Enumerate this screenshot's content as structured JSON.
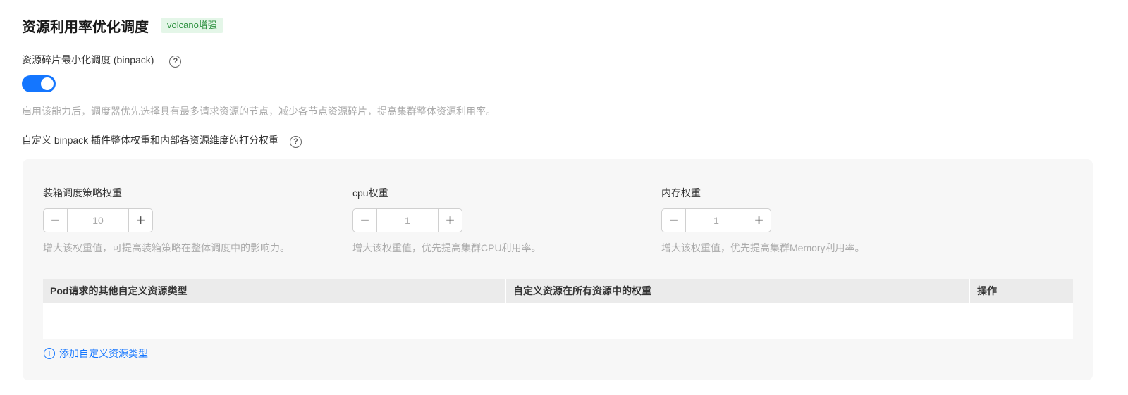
{
  "header": {
    "title": "资源利用率优化调度",
    "tag": "volcano增强"
  },
  "binpack": {
    "label": "资源碎片最小化调度 (binpack)",
    "help_icon": "?",
    "enabled": true,
    "description": "启用该能力后，调度器优先选择具有最多请求资源的节点，减少各节点资源碎片，提高集群整体资源利用率。"
  },
  "custom": {
    "label": "自定义 binpack 插件整体权重和内部各资源维度的打分权重",
    "help_icon": "?"
  },
  "weights": [
    {
      "label": "装箱调度策略权重",
      "value": "10",
      "hint": "增大该权重值，可提高装箱策略在整体调度中的影响力。"
    },
    {
      "label": "cpu权重",
      "value": "1",
      "hint": "增大该权重值，优先提高集群CPU利用率。"
    },
    {
      "label": "内存权重",
      "value": "1",
      "hint": "增大该权重值，优先提高集群Memory利用率。"
    }
  ],
  "stepper": {
    "minus": "−",
    "plus": "+"
  },
  "table": {
    "columns": [
      "Pod请求的其他自定义资源类型",
      "自定义资源在所有资源中的权重",
      "操作"
    ]
  },
  "add_label": "添加自定义资源类型",
  "add_icon": "+"
}
